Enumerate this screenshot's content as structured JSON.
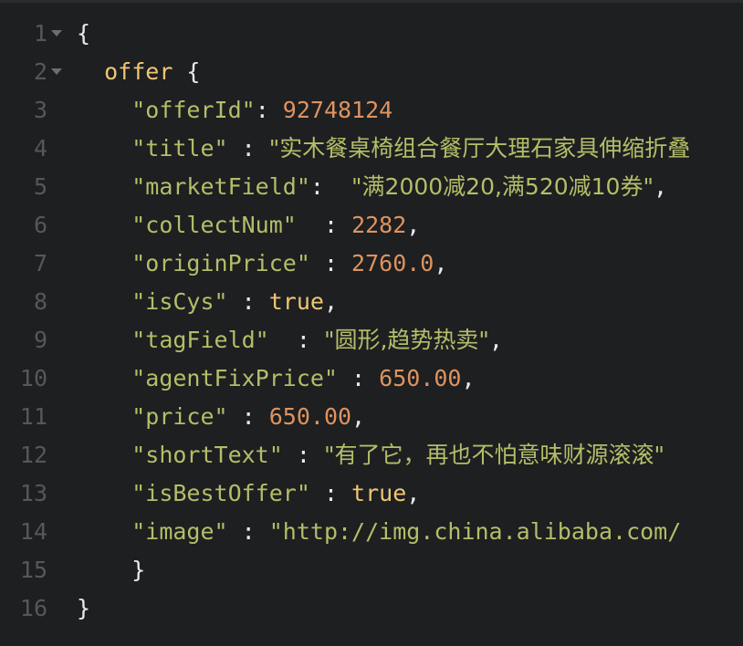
{
  "editor": {
    "lines": [
      {
        "num": "1",
        "fold": true,
        "t": [
          {
            "c": "p",
            "v": "{"
          }
        ]
      },
      {
        "num": "2",
        "fold": true,
        "t": [
          {
            "c": "p",
            "v": "  "
          },
          {
            "c": "b",
            "v": "offer"
          },
          {
            "c": "p",
            "v": " {"
          }
        ]
      },
      {
        "num": "3",
        "t": [
          {
            "c": "p",
            "v": "    "
          },
          {
            "c": "s",
            "v": "\"offerId\""
          },
          {
            "c": "p",
            "v": ": "
          },
          {
            "c": "n",
            "v": "92748124"
          }
        ]
      },
      {
        "num": "4",
        "t": [
          {
            "c": "p",
            "v": "    "
          },
          {
            "c": "s",
            "v": "\"title\""
          },
          {
            "c": "p",
            "v": " : "
          },
          {
            "c": "s",
            "v": "\"实木餐桌椅组合餐厅大理石家具伸缩折叠"
          }
        ]
      },
      {
        "num": "5",
        "t": [
          {
            "c": "p",
            "v": "    "
          },
          {
            "c": "s",
            "v": "\"marketField\""
          },
          {
            "c": "p",
            "v": ":  "
          },
          {
            "c": "s",
            "v": "\"满2000减20,满520减10券\""
          },
          {
            "c": "p",
            "v": ","
          }
        ]
      },
      {
        "num": "6",
        "t": [
          {
            "c": "p",
            "v": "    "
          },
          {
            "c": "s",
            "v": "\"collectNum\""
          },
          {
            "c": "p",
            "v": "  : "
          },
          {
            "c": "n",
            "v": "2282"
          },
          {
            "c": "p",
            "v": ","
          }
        ]
      },
      {
        "num": "7",
        "t": [
          {
            "c": "p",
            "v": "    "
          },
          {
            "c": "s",
            "v": "\"originPrice\""
          },
          {
            "c": "p",
            "v": " : "
          },
          {
            "c": "n",
            "v": "2760.0"
          },
          {
            "c": "p",
            "v": ","
          }
        ]
      },
      {
        "num": "8",
        "t": [
          {
            "c": "p",
            "v": "    "
          },
          {
            "c": "s",
            "v": "\"isCys\""
          },
          {
            "c": "p",
            "v": " : "
          },
          {
            "c": "b",
            "v": "true"
          },
          {
            "c": "p",
            "v": ","
          }
        ]
      },
      {
        "num": "9",
        "t": [
          {
            "c": "p",
            "v": "    "
          },
          {
            "c": "s",
            "v": "\"tagField\""
          },
          {
            "c": "p",
            "v": "  : "
          },
          {
            "c": "s",
            "v": "\"圆形,趋势热卖\""
          },
          {
            "c": "p",
            "v": ","
          }
        ]
      },
      {
        "num": "10",
        "t": [
          {
            "c": "p",
            "v": "    "
          },
          {
            "c": "s",
            "v": "\"agentFixPrice\""
          },
          {
            "c": "p",
            "v": " : "
          },
          {
            "c": "n",
            "v": "650.00"
          },
          {
            "c": "p",
            "v": ","
          }
        ]
      },
      {
        "num": "11",
        "t": [
          {
            "c": "p",
            "v": "    "
          },
          {
            "c": "s",
            "v": "\"price\""
          },
          {
            "c": "p",
            "v": " : "
          },
          {
            "c": "n",
            "v": "650.00"
          },
          {
            "c": "p",
            "v": ","
          }
        ]
      },
      {
        "num": "12",
        "t": [
          {
            "c": "p",
            "v": "    "
          },
          {
            "c": "s",
            "v": "\"shortText\""
          },
          {
            "c": "p",
            "v": " : "
          },
          {
            "c": "s",
            "v": "\"有了它，再也不怕意味财源滚滚\""
          }
        ]
      },
      {
        "num": "13",
        "t": [
          {
            "c": "p",
            "v": "    "
          },
          {
            "c": "s",
            "v": "\"isBestOffer\""
          },
          {
            "c": "p",
            "v": " : "
          },
          {
            "c": "b",
            "v": "true"
          },
          {
            "c": "p",
            "v": ","
          }
        ]
      },
      {
        "num": "14",
        "t": [
          {
            "c": "p",
            "v": "    "
          },
          {
            "c": "s",
            "v": "\"image\""
          },
          {
            "c": "p",
            "v": " : "
          },
          {
            "c": "s",
            "v": "\"http://img.china.alibaba.com/"
          }
        ]
      },
      {
        "num": "15",
        "t": [
          {
            "c": "p",
            "v": "    }"
          }
        ]
      },
      {
        "num": "16",
        "t": [
          {
            "c": "p",
            "v": "}"
          }
        ]
      }
    ]
  },
  "colors": {
    "background": "#1d1f21",
    "gutter": "#55585b",
    "string": "#b5bd68",
    "number": "#de935f",
    "keyword": "#f0c674",
    "punctuation": "#eaeaea"
  }
}
